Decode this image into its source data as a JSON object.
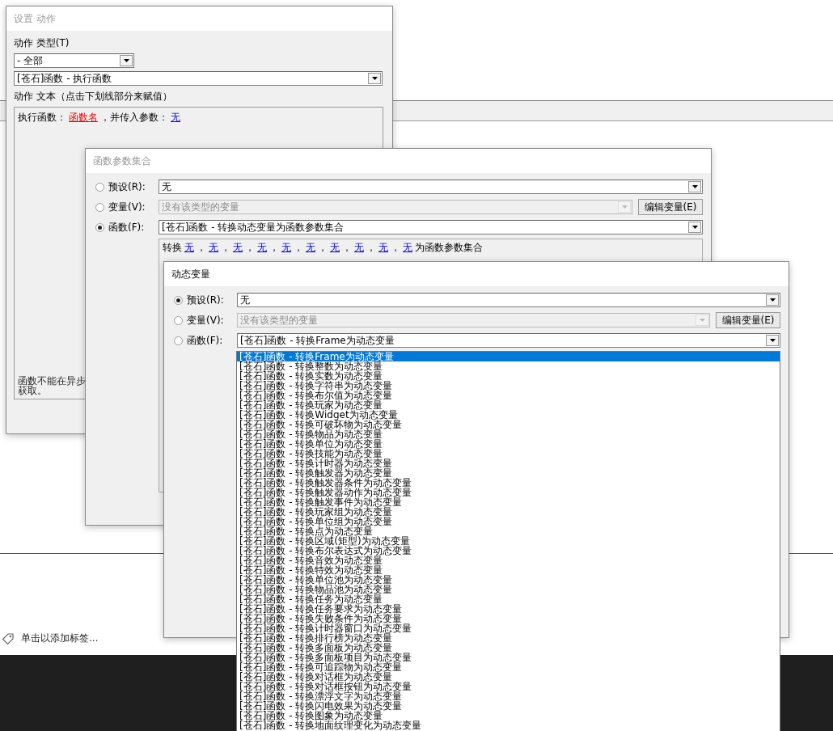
{
  "background": {
    "tag_hint": "单击以添加标签..."
  },
  "windows": [
    {
      "kind": "action",
      "title": "设置 动作",
      "active": false,
      "type_label": "动作 类型(T)",
      "category": "- 全部",
      "action": "[苍石]函数 - 执行函数",
      "text_label": "动作 文本（点击下划线部分来赋值）",
      "action_text": [
        {
          "text": "执行函数：",
          "kind": "plain"
        },
        {
          "text": "函数名",
          "kind": "unset"
        },
        {
          "text": "，并传入参数：",
          "kind": "plain"
        },
        {
          "text": "无",
          "kind": "link"
        }
      ],
      "description": [
        "函数不能在异步",
        "获取。"
      ]
    },
    {
      "kind": "param",
      "title": "函数参数集合",
      "active": false,
      "options": [
        {
          "label": "预设(R):",
          "value": "无",
          "selected": false,
          "disabled": false
        },
        {
          "label": "变量(V):",
          "value": "没有该类型的变量",
          "selected": false,
          "disabled": true,
          "button": "编辑变量(E)"
        },
        {
          "label": "函数(F):",
          "value": "[苍石]函数 - 转换动态变量为函数参数集合",
          "selected": true,
          "disabled": false
        }
      ],
      "expression": [
        {
          "text": "转换",
          "kind": "plain"
        },
        {
          "text": "无",
          "kind": "link"
        },
        {
          "text": "，",
          "kind": "plain"
        },
        {
          "text": "无",
          "kind": "link"
        },
        {
          "text": "，",
          "kind": "plain"
        },
        {
          "text": "无",
          "kind": "link"
        },
        {
          "text": "，",
          "kind": "plain"
        },
        {
          "text": "无",
          "kind": "link"
        },
        {
          "text": "，",
          "kind": "plain"
        },
        {
          "text": "无",
          "kind": "link"
        },
        {
          "text": "，",
          "kind": "plain"
        },
        {
          "text": "无",
          "kind": "link"
        },
        {
          "text": "，",
          "kind": "plain"
        },
        {
          "text": "无",
          "kind": "link"
        },
        {
          "text": "，",
          "kind": "plain"
        },
        {
          "text": "无",
          "kind": "link"
        },
        {
          "text": "，",
          "kind": "plain"
        },
        {
          "text": "无",
          "kind": "link"
        },
        {
          "text": "，",
          "kind": "plain"
        },
        {
          "text": "无",
          "kind": "link"
        },
        {
          "text": "为函数参数集合",
          "kind": "plain"
        }
      ]
    },
    {
      "kind": "param",
      "title": "动态变量",
      "active": true,
      "options": [
        {
          "label": "预设(R):",
          "value": "无",
          "selected": true,
          "disabled": false
        },
        {
          "label": "变量(V):",
          "value": "没有该类型的变量",
          "selected": false,
          "disabled": true,
          "button": "编辑变量(E)"
        },
        {
          "label": "函数(F):",
          "value": "[苍石]函数 - 转换Frame为动态变量",
          "selected": false,
          "disabled": false
        }
      ],
      "dropdown": {
        "items": [
          {
            "text": "[苍石]函数 - 转换Frame为动态变量",
            "selected": true
          },
          {
            "text": "[苍石]函数 - 转换整数为动态变量",
            "selected": false
          },
          {
            "text": "[苍石]函数 - 转换实数为动态变量",
            "selected": false
          },
          {
            "text": "[苍石]函数 - 转换字符串为动态变量",
            "selected": false
          },
          {
            "text": "[苍石]函数 - 转换布尔值为动态变量",
            "selected": false
          },
          {
            "text": "[苍石]函数 - 转换玩家为动态变量",
            "selected": false
          },
          {
            "text": "[苍石]函数 - 转换Widget为动态变量",
            "selected": false
          },
          {
            "text": "[苍石]函数 - 转换可破坏物为动态变量",
            "selected": false
          },
          {
            "text": "[苍石]函数 - 转换物品为动态变量",
            "selected": false
          },
          {
            "text": "[苍石]函数 - 转换单位为动态变量",
            "selected": false
          },
          {
            "text": "[苍石]函数 - 转换技能为动态变量",
            "selected": false
          },
          {
            "text": "[苍石]函数 - 转换计时器为动态变量",
            "selected": false
          },
          {
            "text": "[苍石]函数 - 转换触发器为动态变量",
            "selected": false
          },
          {
            "text": "[苍石]函数 - 转换触发器条件为动态变量",
            "selected": false
          },
          {
            "text": "[苍石]函数 - 转换触发器动作为动态变量",
            "selected": false
          },
          {
            "text": "[苍石]函数 - 转换触发事件为动态变量",
            "selected": false
          },
          {
            "text": "[苍石]函数 - 转换玩家组为动态变量",
            "selected": false
          },
          {
            "text": "[苍石]函数 - 转换单位组为动态变量",
            "selected": false
          },
          {
            "text": "[苍石]函数 - 转换点为动态变量",
            "selected": false
          },
          {
            "text": "[苍石]函数 - 转换区域(矩型)为动态变量",
            "selected": false
          },
          {
            "text": "[苍石]函数 - 转换布尔表达式为动态变量",
            "selected": false
          },
          {
            "text": "[苍石]函数 - 转换音效为动态变量",
            "selected": false
          },
          {
            "text": "[苍石]函数 - 转换特效为动态变量",
            "selected": false
          },
          {
            "text": "[苍石]函数 - 转换单位池为动态变量",
            "selected": false
          },
          {
            "text": "[苍石]函数 - 转换物品池为动态变量",
            "selected": false
          },
          {
            "text": "[苍石]函数 - 转换任务为动态变量",
            "selected": false
          },
          {
            "text": "[苍石]函数 - 转换任务要求为动态变量",
            "selected": false
          },
          {
            "text": "[苍石]函数 - 转换失败条件为动态变量",
            "selected": false
          },
          {
            "text": "[苍石]函数 - 转换计时器窗口为动态变量",
            "selected": false
          },
          {
            "text": "[苍石]函数 - 转换排行榜为动态变量",
            "selected": false
          },
          {
            "text": "[苍石]函数 - 转换多面板为动态变量",
            "selected": false
          },
          {
            "text": "[苍石]函数 - 转换多面板项目为动态变量",
            "selected": false
          },
          {
            "text": "[苍石]函数 - 转换可追踪物为动态变量",
            "selected": false
          },
          {
            "text": "[苍石]函数 - 转换对话框为动态变量",
            "selected": false
          },
          {
            "text": "[苍石]函数 - 转换对话框按钮为动态变量",
            "selected": false
          },
          {
            "text": "[苍石]函数 - 转换漂浮文字为动态变量",
            "selected": false
          },
          {
            "text": "[苍石]函数 - 转换闪电效果为动态变量",
            "selected": false
          },
          {
            "text": "[苍石]函数 - 转换图象为动态变量",
            "selected": false
          },
          {
            "text": "[苍石]函数 - 转换地面纹理变化为动态变量",
            "selected": false
          }
        ]
      }
    }
  ]
}
